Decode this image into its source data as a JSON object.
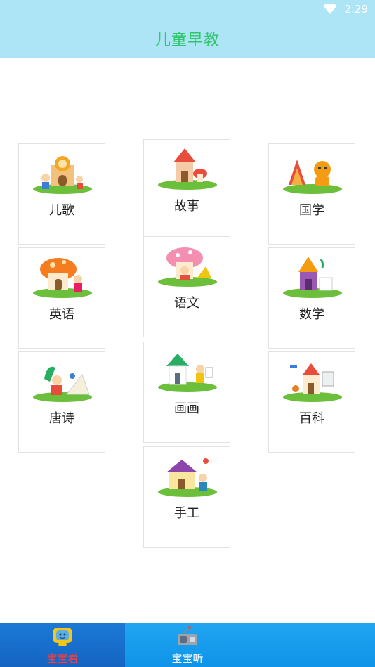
{
  "status_bar": {
    "time": "2:29"
  },
  "app_bar": {
    "title": "儿童早教"
  },
  "tiles": [
    {
      "label": "儿歌",
      "icon": "castle-kids-icon",
      "accent": "#f5a623"
    },
    {
      "label": "故事",
      "icon": "mushroom-house-red-icon",
      "accent": "#e84c3d"
    },
    {
      "label": "国学",
      "icon": "tiger-tent-icon",
      "accent": "#f39c12"
    },
    {
      "label": "英语",
      "icon": "mushroom-house-orange-icon",
      "accent": "#f57c1f"
    },
    {
      "label": "语文",
      "icon": "mushroom-pink-reading-icon",
      "accent": "#f48fb1"
    },
    {
      "label": "数学",
      "icon": "purple-house-icon",
      "accent": "#9b59b6"
    },
    {
      "label": "唐诗",
      "icon": "book-kids-icon",
      "accent": "#e74c3c"
    },
    {
      "label": "画画",
      "icon": "green-house-painting-icon",
      "accent": "#27ae60"
    },
    {
      "label": "百科",
      "icon": "castle-rocket-icon",
      "accent": "#e67e22"
    },
    {
      "label": "手工",
      "icon": "purple-roof-house-icon",
      "accent": "#8e44ad"
    }
  ],
  "bottom_nav": [
    {
      "label": "宝宝看",
      "icon": "tv-icon",
      "active": true
    },
    {
      "label": "宝宝听",
      "icon": "radio-icon",
      "active": false
    }
  ],
  "colors": {
    "header_bg": "#ade4f6",
    "title": "#2ec76c",
    "nav_bg": "#20a6f2",
    "nav_active_bg": "#1b79d6",
    "active_label": "#ff3b3b"
  }
}
